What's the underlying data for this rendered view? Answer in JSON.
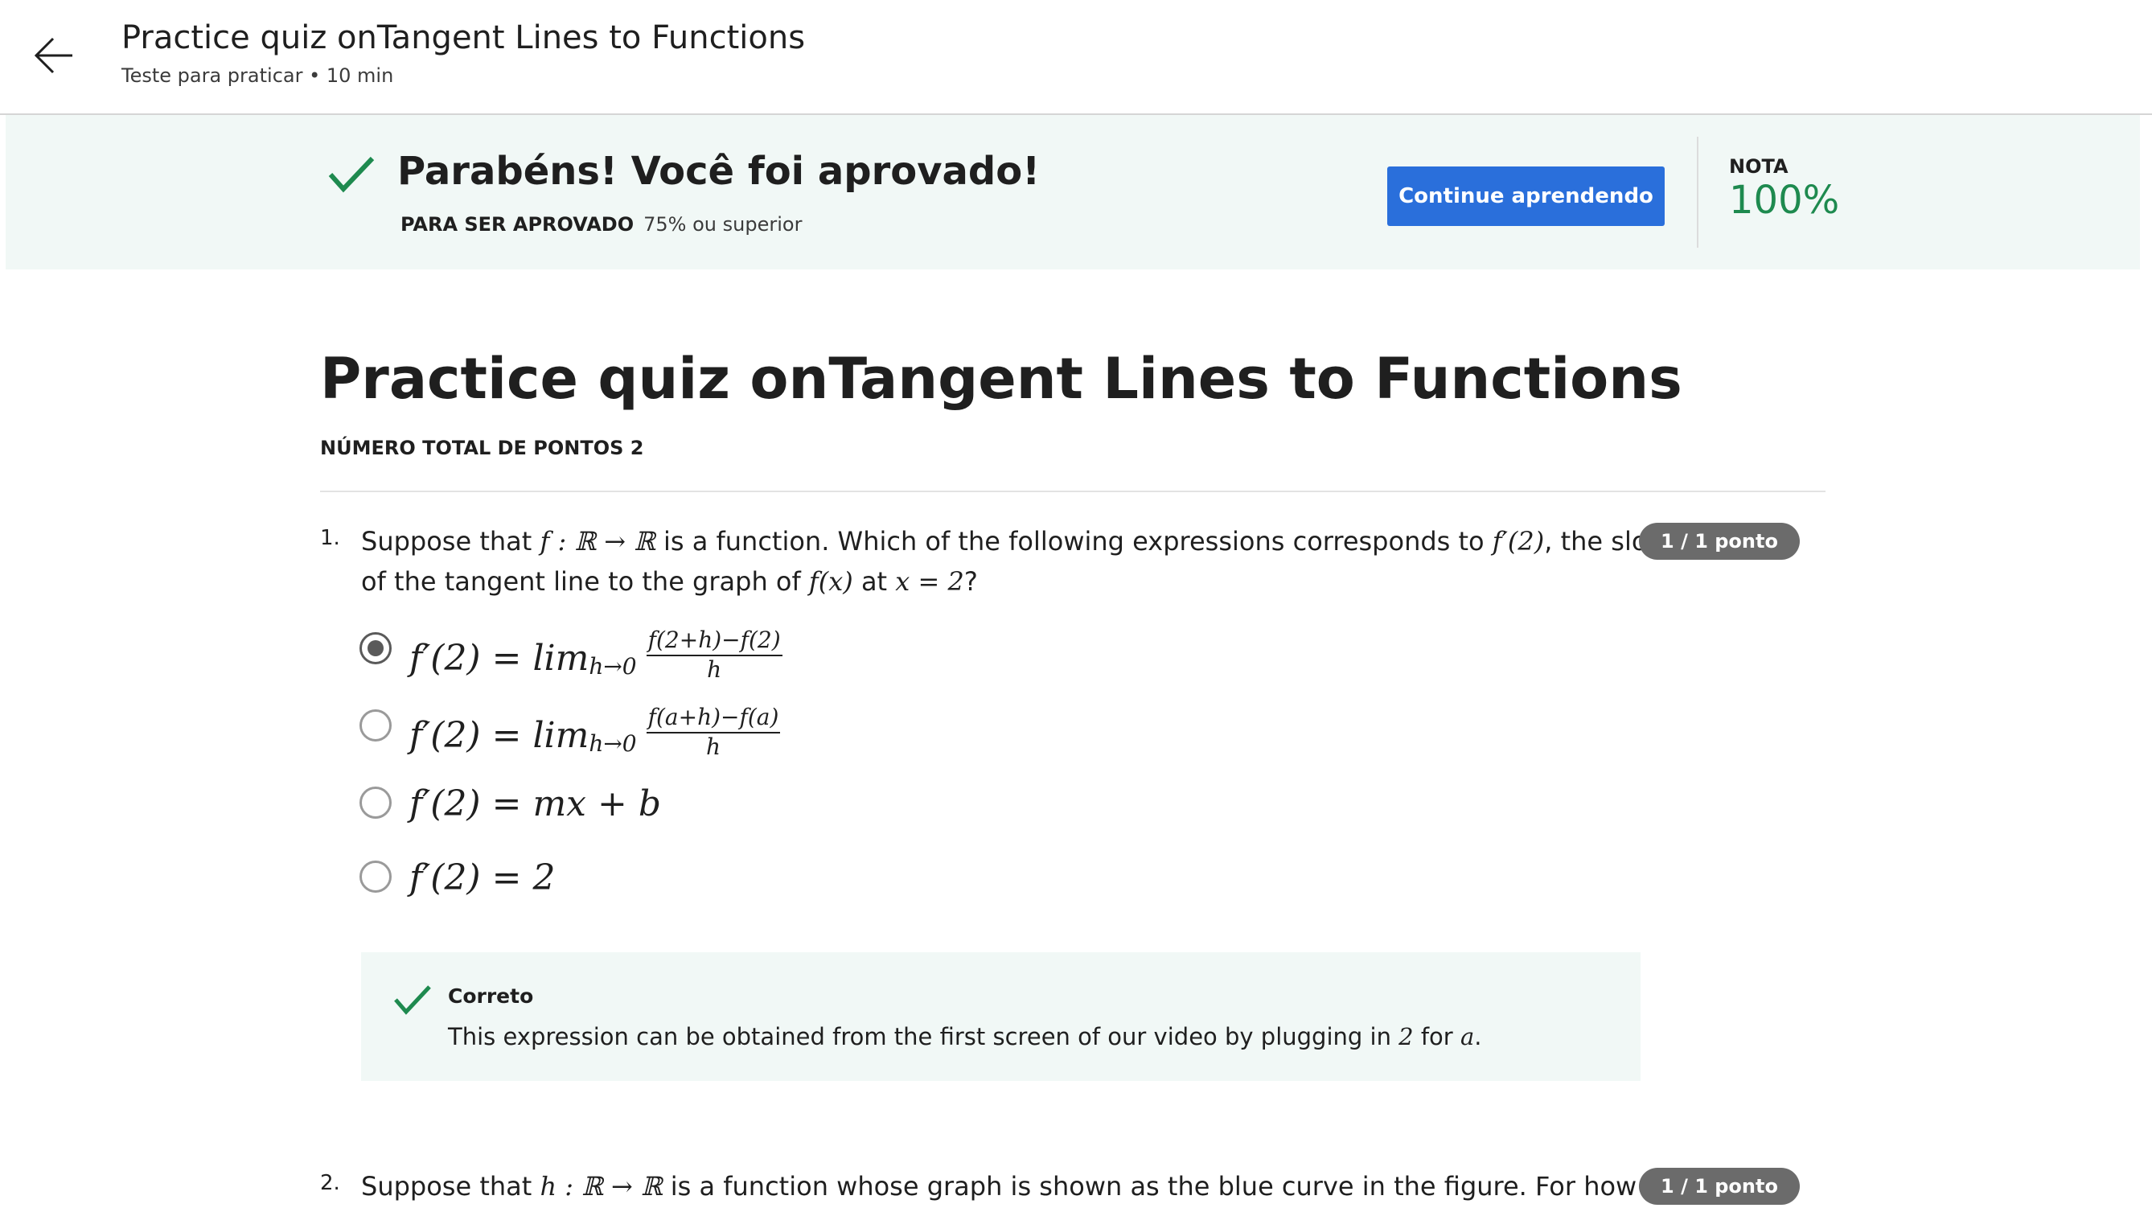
{
  "header": {
    "title": "Practice quiz onTangent Lines to Functions",
    "subtitle": "Teste para praticar • 10 min"
  },
  "banner": {
    "title": "Parabéns! Você foi aprovado!",
    "requirement_label": "PARA SER APROVADO",
    "requirement_value": "75% ou superior",
    "button_label": "Continue aprendendo",
    "grade_label": "NOTA",
    "grade_value": "100%",
    "accent_color": "#1e8a4f",
    "button_color": "#2a6fdb"
  },
  "quiz": {
    "title": "Practice quiz onTangent Lines to Functions",
    "total_points": "NÚMERO TOTAL DE PONTOS 2"
  },
  "questions": [
    {
      "number": "1.",
      "points": "1 / 1 ponto",
      "text_parts": {
        "a": "Suppose that ",
        "b": "f",
        "c": " : ℝ → ℝ",
        "d": " is a function. Which of the following expressions corresponds to ",
        "e": "f′(2)",
        "f": ", the slope",
        "g": "of the tangent line to the graph of ",
        "h": "f(x)",
        "i": " at ",
        "j": "x = 2",
        "k": "?"
      },
      "options": [
        {
          "lhs": "f′(2) = lim",
          "sub": "h→0",
          "num": "f(2+h)−f(2)",
          "den": "h",
          "selected": true
        },
        {
          "lhs": "f′(2) = lim",
          "sub": "h→0",
          "num": "f(a+h)−f(a)",
          "den": "h",
          "selected": false
        },
        {
          "lhs": "f′(2) = mx + b",
          "selected": false
        },
        {
          "lhs": "f′(2) = 2",
          "selected": false
        }
      ],
      "feedback": {
        "title": "Correto",
        "text_a": "This expression can be obtained from the first screen of our video by plugging in ",
        "text_b": "2",
        "text_c": " for ",
        "text_d": "a",
        "text_e": "."
      }
    },
    {
      "number": "2.",
      "points": "1 / 1 ponto",
      "text_parts": {
        "a": "Suppose that ",
        "b": "h",
        "c": " : ℝ → ℝ",
        "d": " is a function whose graph is shown as the blue curve in the figure. For how many"
      }
    }
  ]
}
